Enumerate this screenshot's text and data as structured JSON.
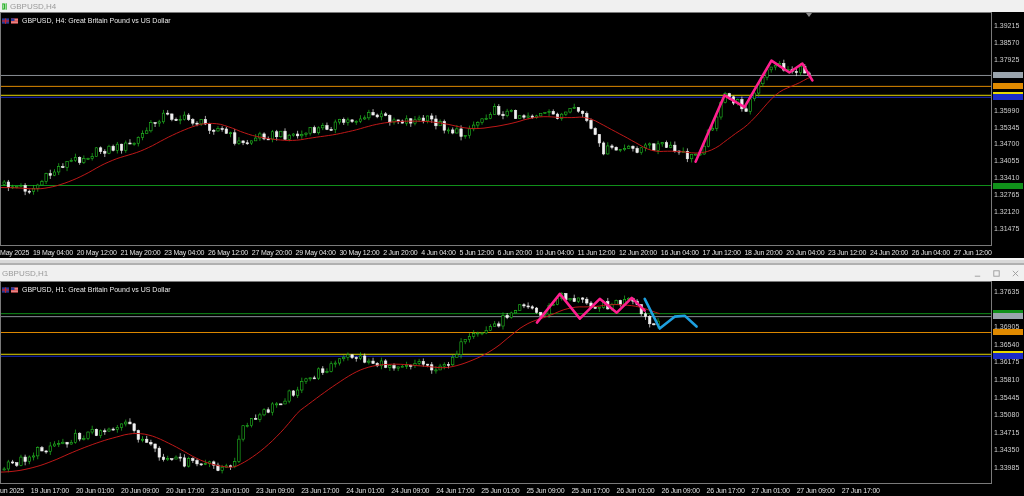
{
  "charts": [
    {
      "window_title": "GBPUSD,H4",
      "window_controls": false,
      "legend": "GBPUSD, H4: Great Britain Pound vs US Dollar",
      "yticks": [
        "1.39215",
        "1.38570",
        "1.37925",
        "1.35990",
        "1.35345",
        "1.34700",
        "1.34055",
        "1.33410",
        "1.32765",
        "1.32120",
        "1.31475"
      ],
      "price_tags": [
        {
          "color": "#9aa4ad"
        },
        {
          "color": "#e08a00"
        },
        {
          "color": "#e6d800"
        },
        {
          "color": "#1a2cc8"
        },
        {
          "color": "#10901a"
        }
      ],
      "xticks": [
        "May 2025",
        "19 May 04:00",
        "20 May 12:00",
        "21 May 20:00",
        "23 May 04:00",
        "26 May 12:00",
        "27 May 20:00",
        "29 May 04:00",
        "30 May 12:00",
        "2 Jun 20:00",
        "4 Jun 04:00",
        "5 Jun 12:00",
        "6 Jun 20:00",
        "10 Jun 04:00",
        "11 Jun 12:00",
        "12 Jun 20:00",
        "16 Jun 04:00",
        "17 Jun 12:00",
        "18 Jun 20:00",
        "20 Jun 04:00",
        "23 Jun 12:00",
        "24 Jun 20:00",
        "26 Jun 04:00",
        "27 Jun 12:00"
      ]
    },
    {
      "window_title": "GBPUSD,H1",
      "window_controls": true,
      "legend": "GBPUSD, H1: Great Britain Pound vs US Dollar",
      "yticks": [
        "1.37635",
        "1.36905",
        "1.36540",
        "1.36175",
        "1.35810",
        "1.35445",
        "1.35080",
        "1.34715",
        "1.34350",
        "1.33985"
      ],
      "price_tags": [
        {
          "color": "#10901a"
        },
        {
          "color": "#9aa4ad"
        },
        {
          "color": "#e08a00"
        },
        {
          "color": "#e6d800"
        },
        {
          "color": "#1a2cc8"
        }
      ],
      "xticks": [
        "un 2025",
        "19 Jun 17:00",
        "20 Jun 01:00",
        "20 Jun 09:00",
        "20 Jun 17:00",
        "23 Jun 01:00",
        "23 Jun 09:00",
        "23 Jun 17:00",
        "24 Jun 01:00",
        "24 Jun 09:00",
        "24 Jun 17:00",
        "25 Jun 01:00",
        "25 Jun 09:00",
        "25 Jun 17:00",
        "26 Jun 01:00",
        "26 Jun 09:00",
        "26 Jun 17:00",
        "27 Jun 01:00",
        "27 Jun 09:00",
        "27 Jun 17:00"
      ]
    }
  ]
}
